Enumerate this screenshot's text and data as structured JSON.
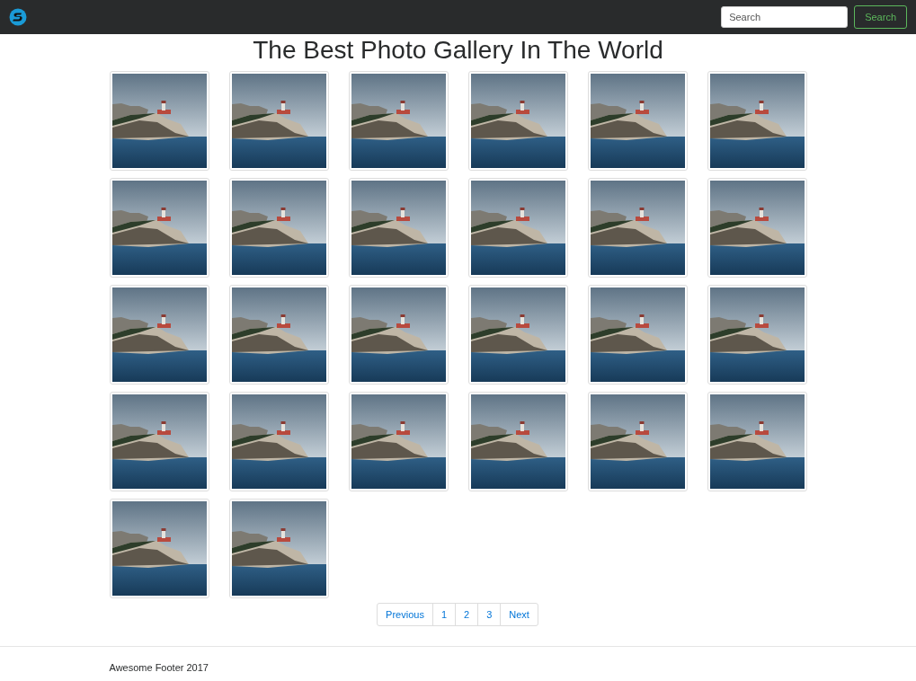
{
  "navbar": {
    "search": {
      "placeholder": "Search"
    },
    "search_button": "Search"
  },
  "title": "The Best Photo Gallery In The World",
  "photos": [
    {
      "kind": "photo"
    },
    {
      "kind": "photo"
    },
    {
      "kind": "photo"
    },
    {
      "kind": "photo"
    },
    {
      "kind": "photo"
    },
    {
      "kind": "photo"
    },
    {
      "kind": "photo"
    },
    {
      "kind": "photo"
    },
    {
      "kind": "photo"
    },
    {
      "kind": "photo"
    },
    {
      "kind": "photo"
    },
    {
      "kind": "photo"
    },
    {
      "kind": "photo"
    },
    {
      "kind": "photo"
    },
    {
      "kind": "photo"
    },
    {
      "kind": "photo"
    },
    {
      "kind": "photo"
    },
    {
      "kind": "photo"
    },
    {
      "kind": "photo"
    },
    {
      "kind": "photo"
    },
    {
      "kind": "photo"
    },
    {
      "kind": "photo"
    },
    {
      "kind": "photo"
    },
    {
      "kind": "photo"
    },
    {
      "kind": "photo"
    },
    {
      "kind": "photo"
    }
  ],
  "pagination": [
    {
      "label": "Previous",
      "selected": false
    },
    {
      "label": "1",
      "selected": false
    },
    {
      "label": "2",
      "selected": false
    },
    {
      "label": "3",
      "selected": false
    },
    {
      "label": "Next",
      "selected": false
    }
  ],
  "footer": "Awesome Footer 2017"
}
